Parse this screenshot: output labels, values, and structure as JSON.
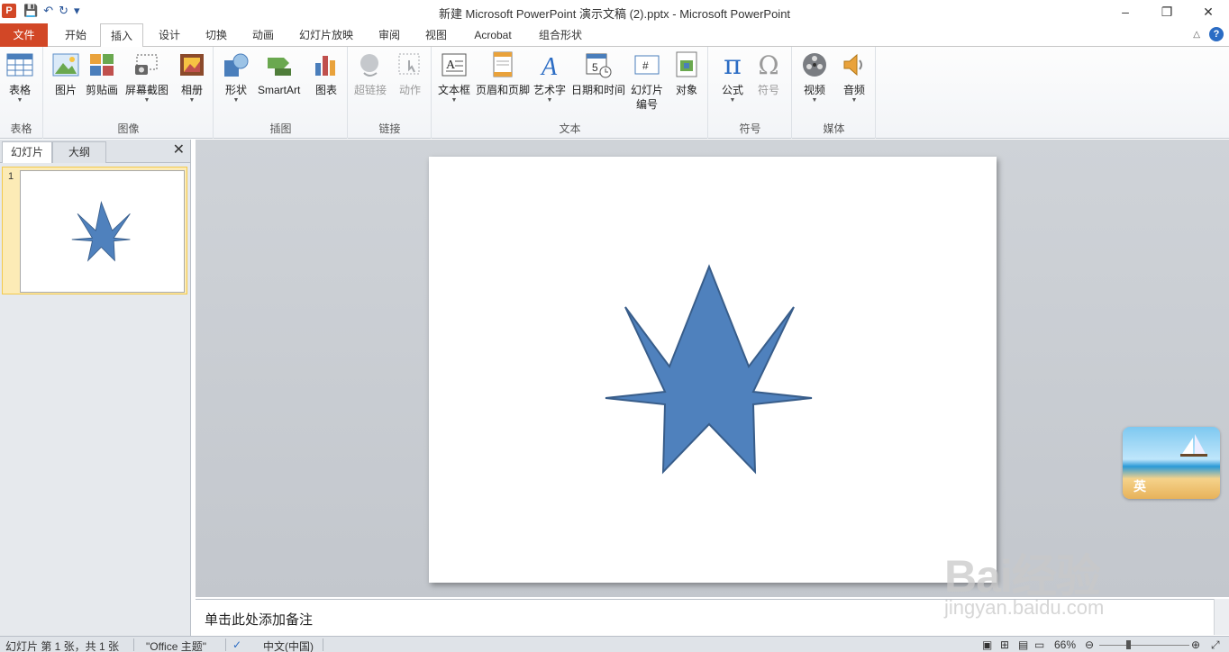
{
  "window": {
    "app_badge": "P",
    "title": "新建 Microsoft PowerPoint 演示文稿 (2).pptx  -  Microsoft PowerPoint",
    "minimize": "–",
    "restore": "❐",
    "close": "✕"
  },
  "qat": {
    "save": "💾",
    "undo": "↶",
    "redo": "↻",
    "customize": "▾"
  },
  "tabs": {
    "file": "文件",
    "items": [
      "开始",
      "插入",
      "设计",
      "切换",
      "动画",
      "幻灯片放映",
      "审阅",
      "视图",
      "Acrobat",
      "组合形状"
    ],
    "active": "插入",
    "collapse": "△",
    "help": "?"
  },
  "ribbon": {
    "groups": {
      "table": "表格",
      "images": "图像",
      "illustrations": "插图",
      "links": "链接",
      "text": "文本",
      "symbols": "符号",
      "media": "媒体"
    },
    "buttons": {
      "table": "表格",
      "picture": "图片",
      "clipart": "剪贴画",
      "screenshot": "屏幕截图",
      "album": "相册",
      "shapes": "形状",
      "smartart": "SmartArt",
      "chart": "图表",
      "hyperlink": "超链接",
      "action": "动作",
      "textbox": "文本框",
      "header_footer": "页眉和页脚",
      "wordart": "艺术字",
      "datetime": "日期和时间",
      "slide_number_1": "幻灯片",
      "slide_number_2": "编号",
      "object": "对象",
      "equation": "公式",
      "symbol": "符号",
      "video": "视频",
      "audio": "音频"
    },
    "arrow": "▼"
  },
  "left_pane": {
    "tab_slides": "幻灯片",
    "tab_outline": "大纲",
    "close": "✕",
    "slide_number": "1"
  },
  "colors": {
    "star_fill": "#4f81bd",
    "star_stroke": "#385d8a",
    "file_tab": "#d24726"
  },
  "notes": {
    "placeholder": "单击此处添加备注"
  },
  "status": {
    "slide_info": "幻灯片 第 1 张，共 1 张",
    "theme": "\"Office 主题\"",
    "language": "中文(中国)",
    "zoom": "66%"
  },
  "ime": {
    "label": "英"
  },
  "watermark": {
    "brand": "Bai经验",
    "url": "jingyan.baidu.com"
  }
}
